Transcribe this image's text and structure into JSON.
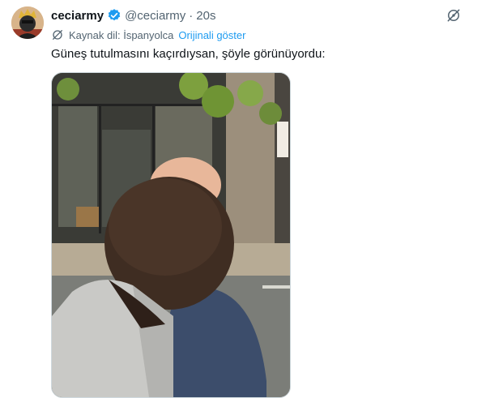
{
  "tweet": {
    "author_name": "ceciarmy",
    "handle": "@ceciarmy",
    "separator": "·",
    "time": "20s",
    "translation": {
      "source_label": "Kaynak dil: İspanyolca",
      "show_original": "Orijinali göster"
    },
    "text": "Güneş tutulmasını kaçırdıysan, şöyle görünüyordu:"
  },
  "icons": {
    "verified": "verified-badge-icon",
    "grok": "grok-icon",
    "translate": "grok-translate-icon"
  },
  "colors": {
    "link": "#1d9bf0",
    "secondary_text": "#536471",
    "verified": "#1d9bf0"
  }
}
